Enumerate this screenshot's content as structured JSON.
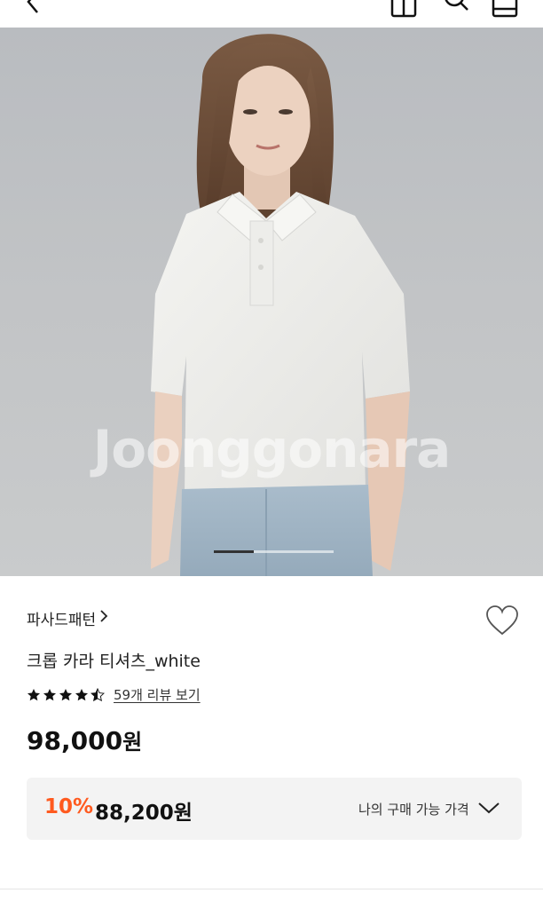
{
  "hero": {
    "watermark": "Joonggonara",
    "slide_index": 1,
    "slide_count": 3
  },
  "product": {
    "brand": "파사드패턴",
    "title": "크롭 카라 티셔츠_white",
    "rating": 4.5,
    "review_link": "59개 리뷰 보기",
    "price": "98,000",
    "price_unit": "원"
  },
  "discount": {
    "percent": "10%",
    "price": "88,200원",
    "label": "나의 구매 가능 가격"
  },
  "colors": {
    "accent": "#ff5a1f",
    "panel": "#f3f3f3"
  },
  "icons": {
    "back": "chevron-left-icon",
    "cart": "cart-icon",
    "search": "search-icon",
    "bag": "bag-icon",
    "wishlist": "heart-icon",
    "star": "star-icon",
    "expand": "chevron-down-icon"
  }
}
